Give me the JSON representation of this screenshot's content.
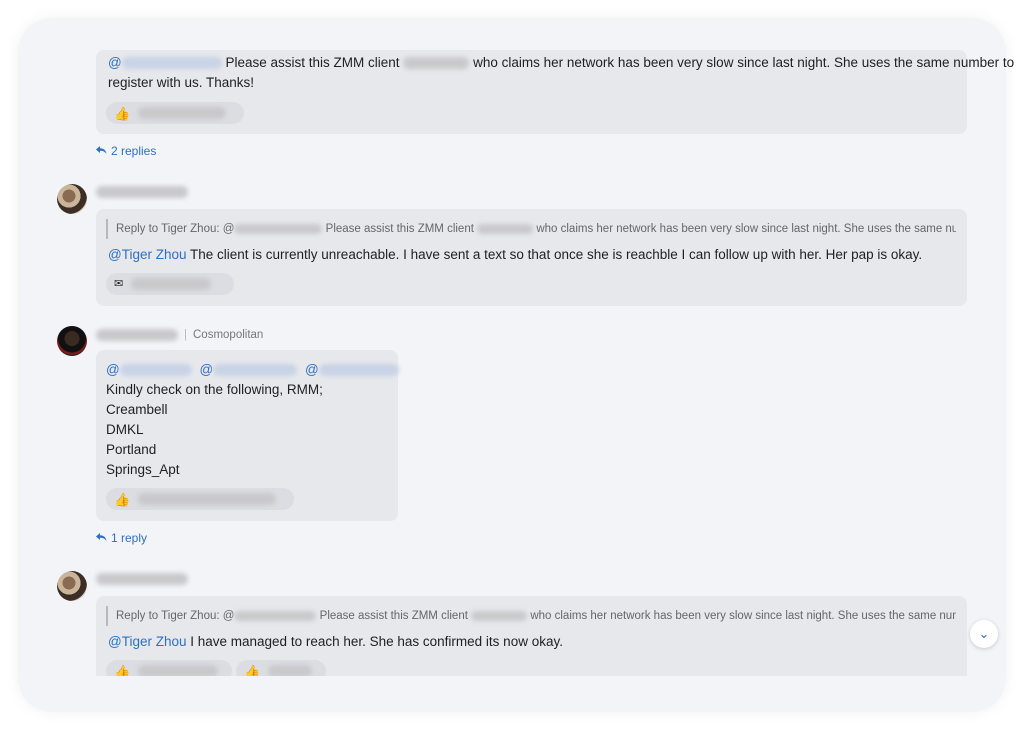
{
  "messages": [
    {
      "text_before_client": "Please assist this ZMM client",
      "text_after_client": "who claims her network has been very slow since last night. She uses the same number to",
      "text_line2": "register with us. Thanks!",
      "mention_prefix": "@",
      "reaction_emoji": "thumbs-up-icon",
      "replies_label": "2 replies"
    },
    {
      "reply_to_label": "Reply to Tiger Zhou:",
      "reply_quote_prefix": "@",
      "reply_quote_mid": "Please assist this ZMM client",
      "reply_quote_end": "who claims her network has been very slow since last night. She uses the same number to...",
      "mention": "@Tiger Zhou",
      "text": "The client is currently unreachable. I have sent a text so that once she is reachble I can follow up with her. Her pap is okay.",
      "reaction_emoji": "envelope-icon"
    },
    {
      "sender_group": "Cosmopolitan",
      "mention_at": "@",
      "lines": [
        "Kindly check on the following, RMM;",
        "Creambell",
        "DMKL",
        "Portland",
        "Springs_Apt"
      ],
      "reaction_emoji": "thumbs-up-icon",
      "replies_label": "1 reply"
    },
    {
      "reply_to_label": "Reply to Tiger Zhou:",
      "reply_quote_prefix": "@",
      "reply_quote_mid": "Please assist this ZMM client",
      "reply_quote_end": "who claims her network has been very slow since last night. She uses the same number to...",
      "mention": "@Tiger Zhou",
      "text": "I have managed to reach her. She has confirmed its now okay.",
      "reaction_emoji": "thumbs-up-icon"
    }
  ],
  "colors": {
    "background": "#f3f4f8",
    "bubble": "#e7e8ec",
    "mention": "#2d6fc4"
  }
}
